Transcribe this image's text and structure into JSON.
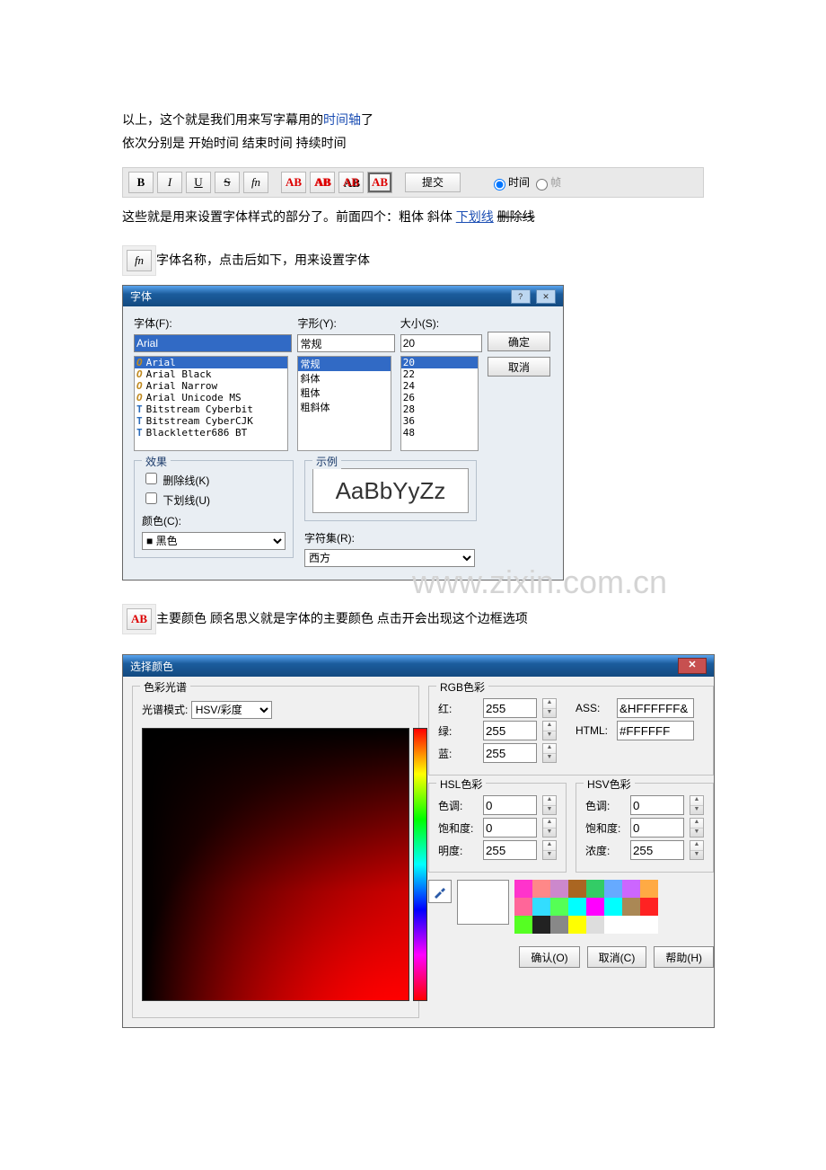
{
  "text": {
    "p1a": "以上，这个就是我们用来写字幕用的",
    "p1link": "时间轴",
    "p1b": "了",
    "p2": "依次分别是 开始时间 结束时间 持续时间",
    "p3a": "这些就是用来设置字体样式的部分了。前面四个：粗体 斜体  ",
    "p3und": "下划线",
    "p3gap": "   ",
    "p3strk": "删除线",
    "p4": "字体名称，点击后如下，用来设置字体",
    "p5": "主要颜色 顾名思义就是字体的主要颜色 点击开会出现这个边框选项"
  },
  "toolbar": {
    "bold": "B",
    "italic": "I",
    "underline": "U",
    "strike": "S",
    "fn": "fn",
    "ab": "AB",
    "submit": "提交",
    "time": "时间",
    "frame": "帧"
  },
  "fn_button": "fn",
  "ab_button": "AB",
  "font_dialog": {
    "title": "字体",
    "font_label": "字体(F):",
    "font_value": "Arial",
    "style_label": "字形(Y):",
    "style_value": "常规",
    "size_label": "大小(S):",
    "size_value": "20",
    "ok": "确定",
    "cancel": "取消",
    "fonts": [
      "Arial",
      "Arial Black",
      "Arial Narrow",
      "Arial Unicode MS",
      "Bitstream Cyberbit",
      "Bitstream CyberCJK",
      "Blackletter686 BT"
    ],
    "styles": [
      "常规",
      "斜体",
      "粗体",
      "粗斜体"
    ],
    "sizes": [
      "20",
      "22",
      "24",
      "26",
      "28",
      "36",
      "48"
    ],
    "effects_title": "效果",
    "strike_chk": "删除线(K)",
    "underline_chk": "下划线(U)",
    "color_label": "颜色(C):",
    "color_value": "黑色",
    "sample_title": "示例",
    "sample_text": "AaBbYyZz",
    "charset_label": "字符集(R):",
    "charset_value": "西方",
    "watermark": "www.zixin.com.cn"
  },
  "color_dialog": {
    "title": "选择颜色",
    "spectrum_title": "色彩光谱",
    "mode_label": "光谱模式:",
    "mode_value": "HSV/彩度",
    "rgb_title": "RGB色彩",
    "r": "红:",
    "g": "绿:",
    "b": "蓝:",
    "rv": "255",
    "gv": "255",
    "bv": "255",
    "ass": "ASS:",
    "assv": "&HFFFFFF&",
    "html": "HTML:",
    "htmlv": "#FFFFFF",
    "hsl_title": "HSL色彩",
    "hsv_title": "HSV色彩",
    "hue": "色调:",
    "sat": "饱和度:",
    "lig": "明度:",
    "val": "浓度:",
    "hsl_h": "0",
    "hsl_s": "0",
    "hsl_l": "255",
    "hsv_h": "0",
    "hsv_s": "0",
    "hsv_v": "255",
    "ok": "确认(O)",
    "cancel": "取消(C)",
    "help": "帮助(H)",
    "palette": [
      "#ff33cc",
      "#ff8888",
      "#cc88cc",
      "#aa6622",
      "#33cc66",
      "#66aaff",
      "#cc66ff",
      "#ffaa44",
      "#ff6699",
      "#33ddff",
      "#55ff55",
      "#00ffff",
      "#ff00ff",
      "#00ffff",
      "#aa8855",
      "#ff2222",
      "#55ff22",
      "#222222",
      "#888888",
      "#ffff00",
      "#dddddd",
      "#ffffff",
      "#ffffff",
      "#ffffff"
    ]
  }
}
